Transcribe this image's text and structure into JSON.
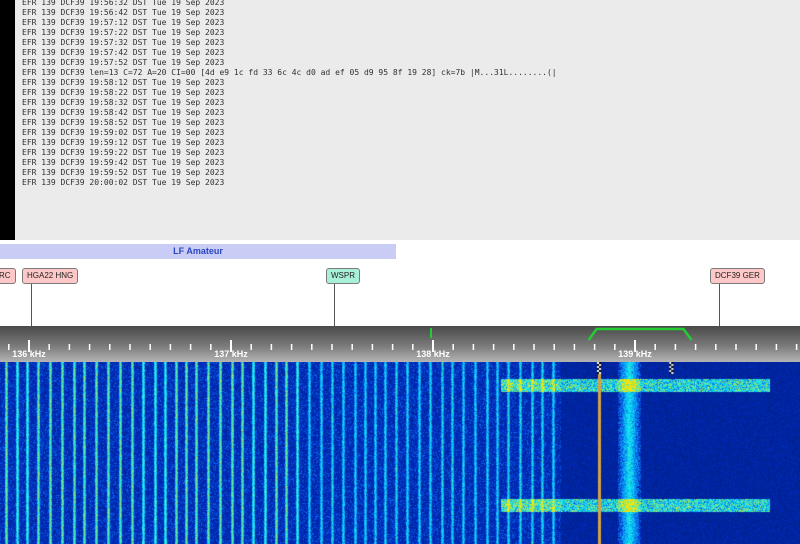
{
  "log": {
    "lines": [
      "EFR 139 DCF39 19:56:32 DST Tue 19 Sep 2023",
      "EFR 139 DCF39 19:56:42 DST Tue 19 Sep 2023",
      "EFR 139 DCF39 19:57:12 DST Tue 19 Sep 2023",
      "EFR 139 DCF39 19:57:22 DST Tue 19 Sep 2023",
      "EFR 139 DCF39 19:57:32 DST Tue 19 Sep 2023",
      "EFR 139 DCF39 19:57:42 DST Tue 19 Sep 2023",
      "EFR 139 DCF39 19:57:52 DST Tue 19 Sep 2023",
      "EFR 139 DCF39 len=13 C=72 A=20 CI=00 [4d e9 1c fd 33 6c 4c d0 ad ef 05 d9 95 8f 19 28] ck=7b |M...31L........(|",
      "EFR 139 DCF39 19:58:12 DST Tue 19 Sep 2023",
      "EFR 139 DCF39 19:58:22 DST Tue 19 Sep 2023",
      "EFR 139 DCF39 19:58:32 DST Tue 19 Sep 2023",
      "EFR 139 DCF39 19:58:42 DST Tue 19 Sep 2023",
      "EFR 139 DCF39 19:58:52 DST Tue 19 Sep 2023",
      "EFR 139 DCF39 19:59:02 DST Tue 19 Sep 2023",
      "EFR 139 DCF39 19:59:12 DST Tue 19 Sep 2023",
      "EFR 139 DCF39 19:59:22 DST Tue 19 Sep 2023",
      "EFR 139 DCF39 19:59:42 DST Tue 19 Sep 2023",
      "EFR 139 DCF39 19:59:52 DST Tue 19 Sep 2023",
      "EFR 139 DCF39 20:00:02 DST Tue 19 Sep 2023"
    ]
  },
  "band": {
    "label": "LF Amateur"
  },
  "stations": [
    {
      "id": "partial",
      "label": "RC",
      "freq_khz": 135.93,
      "color": "#ffc8c8"
    },
    {
      "id": "hga22",
      "label": "HGA22 HNG",
      "freq_khz": 135.955,
      "color": "#ffc8c8"
    },
    {
      "id": "wspr",
      "label": "WSPR",
      "freq_khz": 137.5,
      "color": "#a8f0d8"
    },
    {
      "id": "dcf39",
      "label": "DCF39 GER",
      "freq_khz": 139.4,
      "color": "#ffc8c8"
    }
  ],
  "scale": {
    "ticks": [
      {
        "khz": 136,
        "label": "136 kHz"
      },
      {
        "khz": 137,
        "label": "137 kHz"
      },
      {
        "khz": 138,
        "label": "138 kHz"
      },
      {
        "khz": 139,
        "label": "139 kHz"
      }
    ],
    "marker_khz": 138.0,
    "passband_khz": [
      138.8,
      139.25
    ],
    "accent": "#22cc33"
  },
  "waterfall": {
    "carrier_khz": 138.82,
    "carrier_color": "#d8a040",
    "signal_khz": 138.97
  }
}
